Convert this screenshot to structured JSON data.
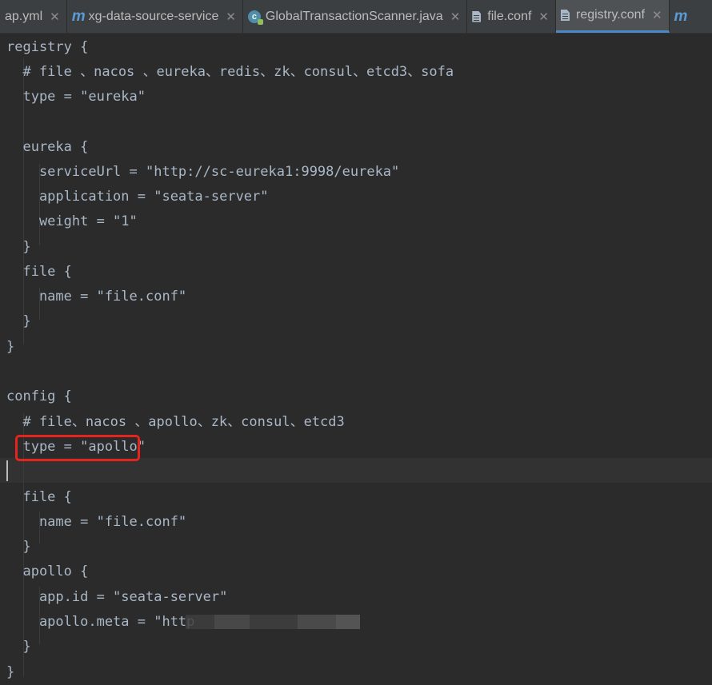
{
  "tabs": [
    {
      "label": "ap.yml",
      "icon": "yaml-file-icon",
      "active": false
    },
    {
      "label": "xg-data-source-service",
      "icon": "maven-module-icon",
      "active": false
    },
    {
      "label": "GlobalTransactionScanner.java",
      "icon": "java-class-icon",
      "active": false
    },
    {
      "label": "file.conf",
      "icon": "text-file-icon",
      "active": false
    },
    {
      "label": "registry.conf",
      "icon": "text-file-icon",
      "active": true
    }
  ],
  "code_lines": [
    "registry {",
    "  # file 、nacos 、eureka、redis、zk、consul、etcd3、sofa",
    "  type = \"eureka\"",
    "",
    "  eureka {",
    "    serviceUrl = \"http://sc-eureka1:9998/eureka\"",
    "    application = \"seata-server\"",
    "    weight = \"1\"",
    "  }",
    "  file {",
    "    name = \"file.conf\"",
    "  }",
    "}",
    "",
    "config {",
    "  # file、nacos 、apollo、zk、consul、etcd3",
    "  type = \"apollo\"",
    "",
    "  file {",
    "    name = \"file.conf\"",
    "  }",
    "  apollo {",
    "    app.id = \"seata-server\"",
    "    apollo.meta = \"http",
    "  }",
    "}"
  ],
  "colors": {
    "editor_bg": "#2b2b2b",
    "text": "#a9b7c6",
    "highlight_border": "#e5241d",
    "active_tab_underline": "#4a88c7"
  }
}
